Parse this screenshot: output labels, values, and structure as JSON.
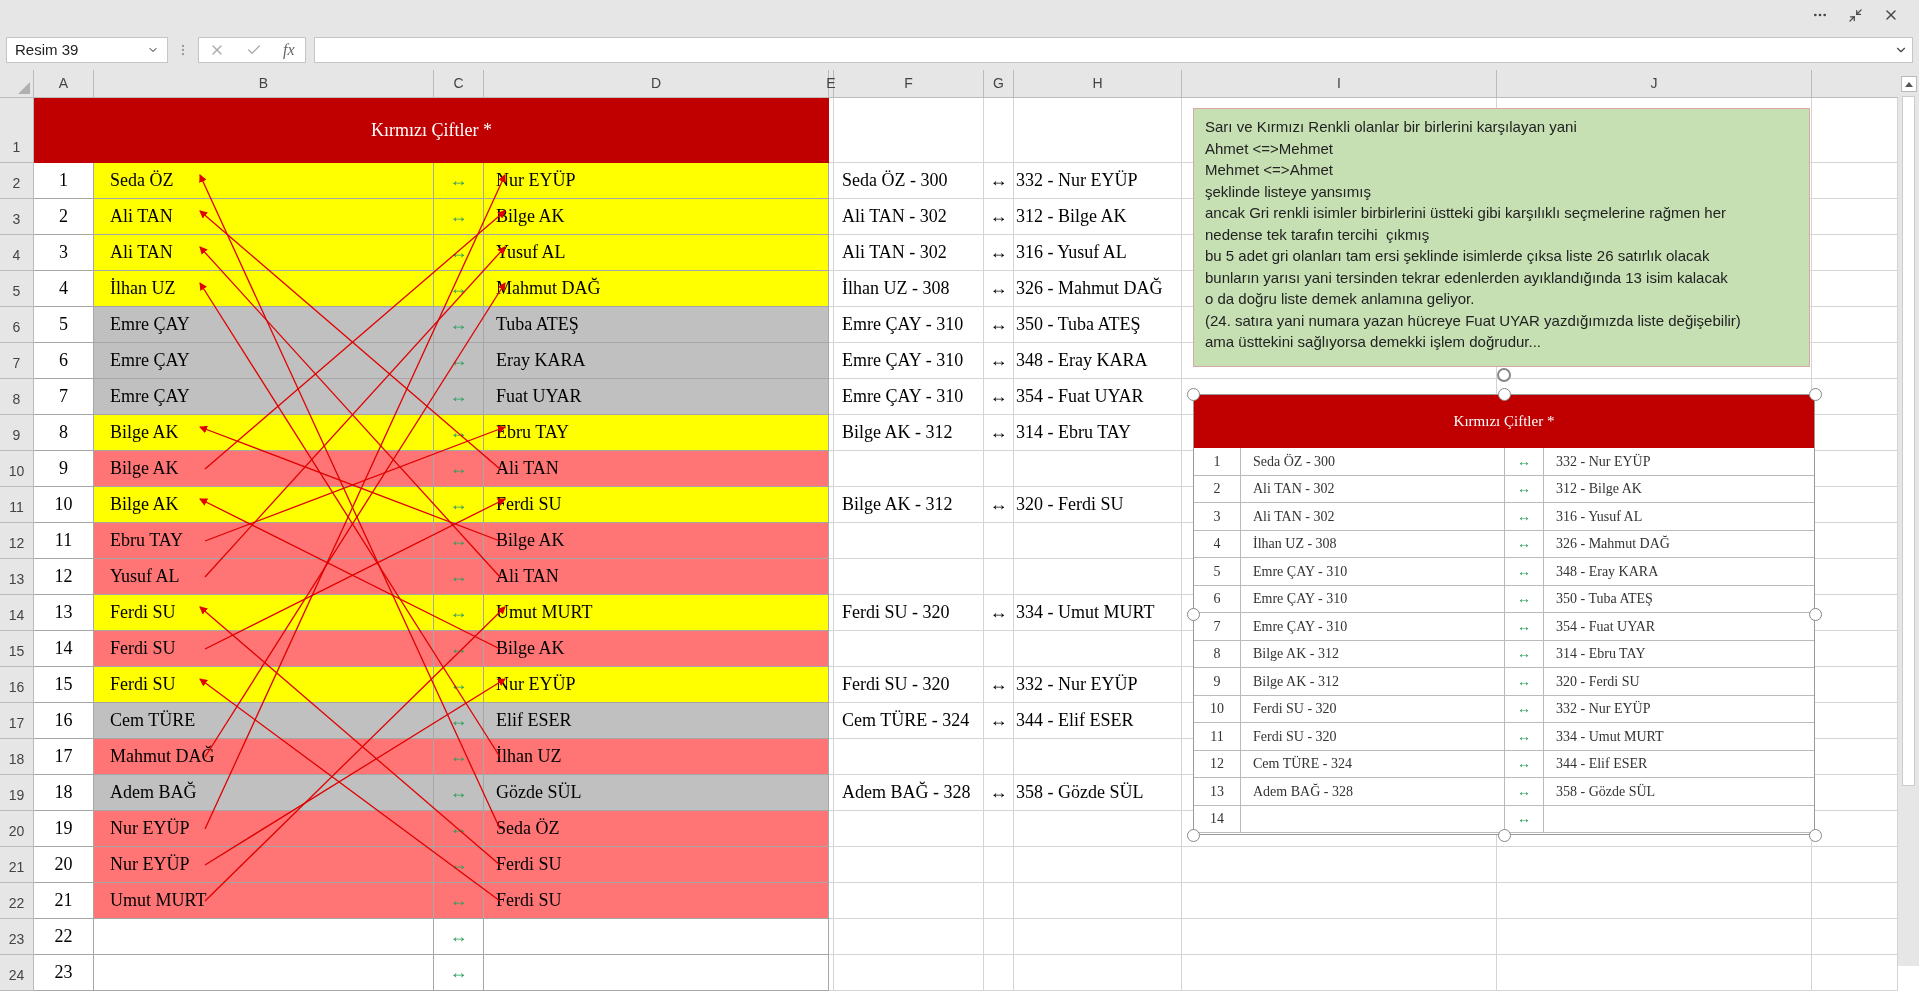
{
  "name_box": "Resim 39",
  "formula_bar": {
    "function_label": "fx"
  },
  "columns": [
    "A",
    "B",
    "C",
    "D",
    "E",
    "F",
    "G",
    "H",
    "I",
    "J"
  ],
  "sheet": {
    "title": "Kırmızı Çiftler *",
    "title_row": "1",
    "rows": [
      {
        "row": "2",
        "num": "1",
        "left": "Seda ÖZ",
        "arrow": "↔",
        "right": "Nur EYÜP",
        "color": "#ffff00",
        "f": "Seda ÖZ - 300",
        "g": "↔",
        "h": "332 - Nur EYÜP"
      },
      {
        "row": "3",
        "num": "2",
        "left": "Ali TAN",
        "arrow": "↔",
        "right": "Bilge AK",
        "color": "#ffff00",
        "f": "Ali TAN - 302",
        "g": "↔",
        "h": "312 - Bilge AK"
      },
      {
        "row": "4",
        "num": "3",
        "left": "Ali TAN",
        "arrow": "↔",
        "right": "Yusuf AL",
        "color": "#ffff00",
        "f": "Ali TAN - 302",
        "g": "↔",
        "h": "316 - Yusuf AL"
      },
      {
        "row": "5",
        "num": "4",
        "left": "İlhan UZ",
        "arrow": "↔",
        "right": "Mahmut DAĞ",
        "color": "#ffff00",
        "f": "İlhan UZ - 308",
        "g": "↔",
        "h": "326 - Mahmut DAĞ"
      },
      {
        "row": "6",
        "num": "5",
        "left": "Emre ÇAY",
        "arrow": "↔",
        "right": "Tuba ATEŞ",
        "color": "#c0c0c0",
        "f": "Emre ÇAY - 310",
        "g": "↔",
        "h": "350 - Tuba ATEŞ"
      },
      {
        "row": "7",
        "num": "6",
        "left": "Emre ÇAY",
        "arrow": "↔",
        "right": "Eray KARA",
        "color": "#c0c0c0",
        "f": "Emre ÇAY - 310",
        "g": "↔",
        "h": "348 - Eray KARA"
      },
      {
        "row": "8",
        "num": "7",
        "left": "Emre ÇAY",
        "arrow": "↔",
        "right": "Fuat UYAR",
        "color": "#c0c0c0",
        "f": "Emre ÇAY - 310",
        "g": "↔",
        "h": "354 - Fuat UYAR"
      },
      {
        "row": "9",
        "num": "8",
        "left": "Bilge AK",
        "arrow": "↔",
        "right": "Ebru TAY",
        "color": "#ffff00",
        "f": "Bilge AK - 312",
        "g": "↔",
        "h": "314 - Ebru TAY"
      },
      {
        "row": "10",
        "num": "9",
        "left": "Bilge AK",
        "arrow": "↔",
        "right": "Ali TAN",
        "color": "#ff7575"
      },
      {
        "row": "11",
        "num": "10",
        "left": "Bilge AK",
        "arrow": "↔",
        "right": "Ferdi SU",
        "color": "#ffff00",
        "f": "Bilge AK - 312",
        "g": "↔",
        "h": "320 - Ferdi SU"
      },
      {
        "row": "12",
        "num": "11",
        "left": "Ebru TAY",
        "arrow": "↔",
        "right": "Bilge AK",
        "color": "#ff7575"
      },
      {
        "row": "13",
        "num": "12",
        "left": "Yusuf AL",
        "arrow": "↔",
        "right": "Ali TAN",
        "color": "#ff7575"
      },
      {
        "row": "14",
        "num": "13",
        "left": "Ferdi SU",
        "arrow": "↔",
        "right": "Umut MURT",
        "color": "#ffff00",
        "f": "Ferdi SU - 320",
        "g": "↔",
        "h": "334 - Umut MURT"
      },
      {
        "row": "15",
        "num": "14",
        "left": "Ferdi SU",
        "arrow": "↔",
        "right": "Bilge AK",
        "color": "#ff7575"
      },
      {
        "row": "16",
        "num": "15",
        "left": "Ferdi SU",
        "arrow": "↔",
        "right": "Nur EYÜP",
        "color": "#ffff00",
        "f": "Ferdi SU - 320",
        "g": "↔",
        "h": "332 - Nur EYÜP"
      },
      {
        "row": "17",
        "num": "16",
        "left": "Cem TÜRE",
        "arrow": "↔",
        "right": "Elif ESER",
        "color": "#c0c0c0",
        "f": "Cem TÜRE - 324",
        "g": "↔",
        "h": "344 - Elif ESER"
      },
      {
        "row": "18",
        "num": "17",
        "left": "Mahmut DAĞ",
        "arrow": "↔",
        "right": "İlhan UZ",
        "color": "#ff7575"
      },
      {
        "row": "19",
        "num": "18",
        "left": "Adem BAĞ",
        "arrow": "↔",
        "right": "Gözde SÜL",
        "color": "#c0c0c0",
        "f": "Adem BAĞ - 328",
        "g": "↔",
        "h": "358 - Gözde SÜL"
      },
      {
        "row": "20",
        "num": "19",
        "left": "Nur EYÜP",
        "arrow": "↔",
        "right": "Seda ÖZ",
        "color": "#ff7575"
      },
      {
        "row": "21",
        "num": "20",
        "left": "Nur EYÜP",
        "arrow": "↔",
        "right": "Ferdi SU",
        "color": "#ff7575"
      },
      {
        "row": "22",
        "num": "21",
        "left": "Umut MURT",
        "arrow": "↔",
        "right": "Ferdi SU",
        "color": "#ff7575"
      },
      {
        "row": "23",
        "num": "22",
        "arrow": "↔",
        "color": "#ffffff"
      },
      {
        "row": "24",
        "num": "23",
        "arrow": "↔",
        "color": "#ffffff"
      }
    ]
  },
  "note": {
    "lines": [
      "Sarı ve Kırmızı Renkli olanlar bir birlerini karşılayan yani",
      "Ahmet <=>Mehmet",
      "Mehmet <=>Ahmet",
      "şeklinde listeye yansımış",
      "ancak Gri renkli isimler birbirlerini üstteki gibi karşılıklı seçmelerine rağmen her",
      "nedense tek tarafın tercihi  çıkmış",
      "bu 5 adet gri olanları tam ersi şeklinde isimlerde çıksa liste 26 satırlık olacak",
      "bunların yarısı yani tersinden tekrar edenlerden ayıklandığında 13 isim kalacak",
      "o da doğru liste demek anlamına geliyor.",
      "(24. satıra yani numara yazan hücreye Fuat UYAR yazdığımızda liste değişebilir)",
      "ama üsttekini sağlıyorsa demekki işlem doğrudur..."
    ]
  },
  "picture_table": {
    "title": "Kırmızı Çiftler *",
    "rows": [
      {
        "num": "1",
        "left": "Seda ÖZ - 300",
        "arrow": "↔",
        "right": "332 - Nur EYÜP"
      },
      {
        "num": "2",
        "left": "Ali TAN - 302",
        "arrow": "↔",
        "right": "312 - Bilge AK"
      },
      {
        "num": "3",
        "left": "Ali TAN - 302",
        "arrow": "↔",
        "right": "316 - Yusuf AL"
      },
      {
        "num": "4",
        "left": "İlhan UZ - 308",
        "arrow": "↔",
        "right": "326 - Mahmut DAĞ"
      },
      {
        "num": "5",
        "left": "Emre ÇAY - 310",
        "arrow": "↔",
        "right": "348 - Eray KARA"
      },
      {
        "num": "6",
        "left": "Emre ÇAY - 310",
        "arrow": "↔",
        "right": "350 - Tuba ATEŞ"
      },
      {
        "num": "7",
        "left": "Emre ÇAY - 310",
        "arrow": "↔",
        "right": "354 - Fuat UYAR"
      },
      {
        "num": "8",
        "left": "Bilge AK - 312",
        "arrow": "↔",
        "right": "314 - Ebru TAY"
      },
      {
        "num": "9",
        "left": "Bilge AK - 312",
        "arrow": "↔",
        "right": "320 - Ferdi SU"
      },
      {
        "num": "10",
        "left": "Ferdi SU - 320",
        "arrow": "↔",
        "right": "332 - Nur EYÜP"
      },
      {
        "num": "11",
        "left": "Ferdi SU - 320",
        "arrow": "↔",
        "right": "334 - Umut MURT"
      },
      {
        "num": "12",
        "left": "Cem TÜRE - 324",
        "arrow": "↔",
        "right": "344 - Elif ESER"
      },
      {
        "num": "13",
        "left": "Adem BAĞ - 328",
        "arrow": "↔",
        "right": "358 - Gözde SÜL"
      },
      {
        "num": "14",
        "arrow": "↔"
      }
    ]
  }
}
